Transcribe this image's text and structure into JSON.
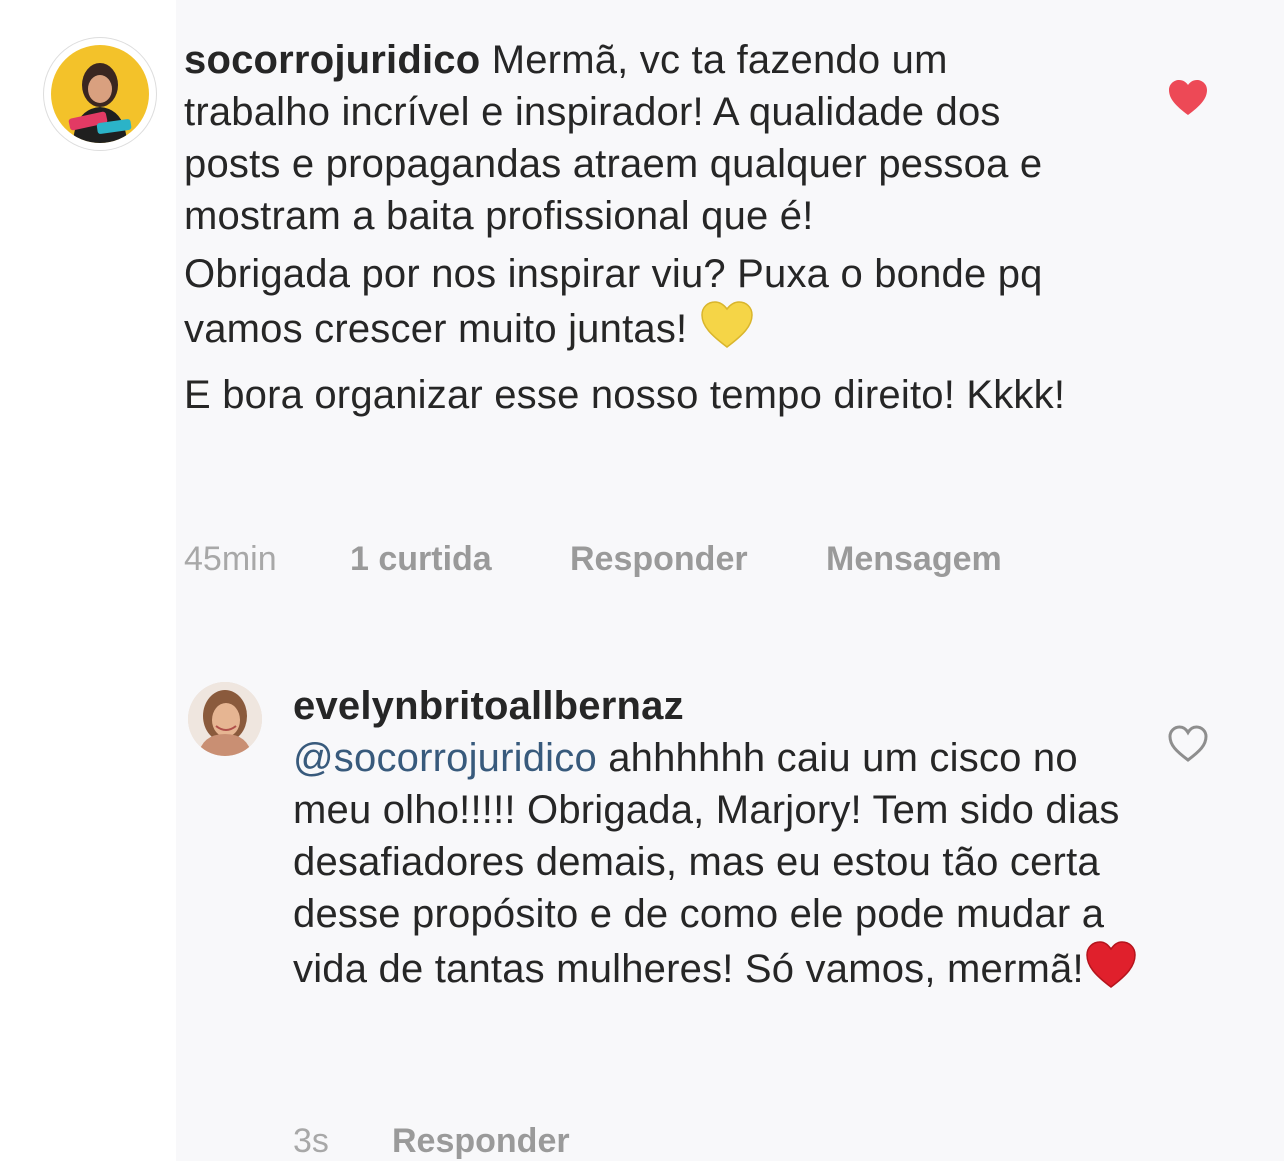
{
  "comments": [
    {
      "username": "socorrojuridico",
      "paragraphs": [
        "Mermã, vc ta fazendo um trabalho incrível e inspirador! A qualidade dos posts e propagandas atraem qualquer pessoa e mostram a baita profissional que é!",
        "Obrigada por nos inspirar viu? Puxa o bonde pq vamos crescer muito juntas!",
        "E bora organizar esse nosso tempo direito! Kkkk!"
      ],
      "emoji": "yellow-heart-icon",
      "time": "45min",
      "likes": "1 curtida",
      "reply_label": "Responder",
      "message_label": "Mensagem",
      "liked": true,
      "avatar_icon": "profile-avatar-icon"
    },
    {
      "username": "evelynbritoallbernaz",
      "mention": "@socorrojuridico",
      "body": " ahhhhhh caiu um cisco no meu olho!!!!! Obrigada, Marjory! Tem sido dias desafiadores demais, mas eu estou tão certa desse propósito e de como ele pode mudar a vida de tantas mulheres! Só vamos, mermã!",
      "emoji": "red-heart-icon",
      "time": "3s",
      "reply_label": "Responder",
      "liked": false,
      "avatar_icon": "profile-avatar-icon"
    }
  ],
  "colors": {
    "text": "#262626",
    "meta": "#9a9a9a",
    "mention": "#385a7c",
    "like_red": "#ed4956",
    "emoji_yellow": "#f5d547",
    "panel_bg": "#f8f8fa"
  }
}
